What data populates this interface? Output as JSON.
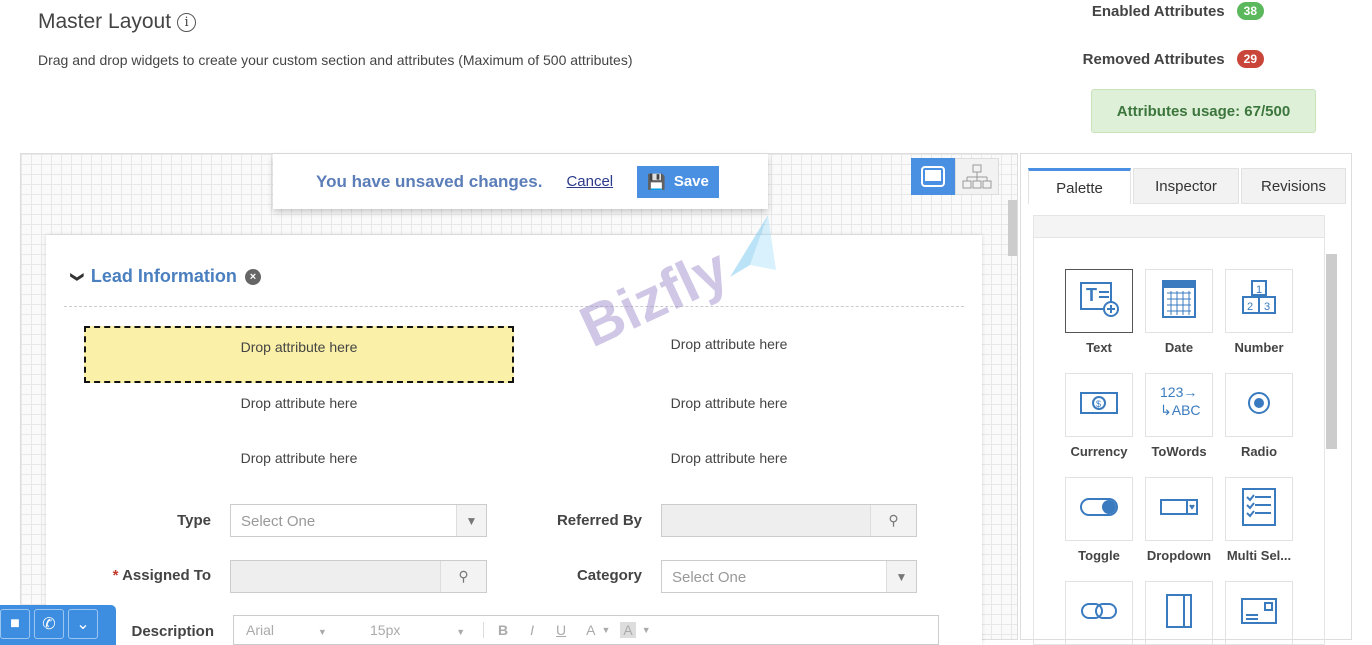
{
  "header": {
    "title": "Master Layout",
    "info_icon": "i",
    "subtitle": "Drag and drop widgets to create your custom section and attributes (Maximum of 500 attributes)"
  },
  "stats": {
    "enabled_label": "Enabled Attributes",
    "enabled_count": "38",
    "enabled_color": "#5cb85c",
    "removed_label": "Removed Attributes",
    "removed_count": "29",
    "removed_color": "#c9453a",
    "usage": "Attributes usage: 67/500"
  },
  "unsaved": {
    "message": "You have unsaved changes.",
    "cancel": "Cancel",
    "save": "Save"
  },
  "section": {
    "title": "Lead Information",
    "close": "×"
  },
  "drop_label": "Drop attribute here",
  "fields": {
    "type": {
      "label": "Type",
      "placeholder": "Select One"
    },
    "referred_by": {
      "label": "Referred By",
      "value": ""
    },
    "assigned_to": {
      "label": "Assigned To",
      "required": "*",
      "value": ""
    },
    "category": {
      "label": "Category",
      "placeholder": "Select One"
    },
    "description": {
      "label": "Description",
      "font": "Arial",
      "size": "15px",
      "bold": "B",
      "italic": "I",
      "underline": "U",
      "color": "A",
      "bg": "A"
    }
  },
  "panel": {
    "tabs": [
      "Palette",
      "Inspector",
      "Revisions"
    ],
    "active_tab": "Palette",
    "widgets": [
      "Text",
      "Date",
      "Number",
      "Currency",
      "ToWords",
      "Radio",
      "Toggle",
      "Dropdown",
      "Multi Sel..."
    ]
  },
  "watermark": "Bizfly",
  "accent": "#4a90e2"
}
